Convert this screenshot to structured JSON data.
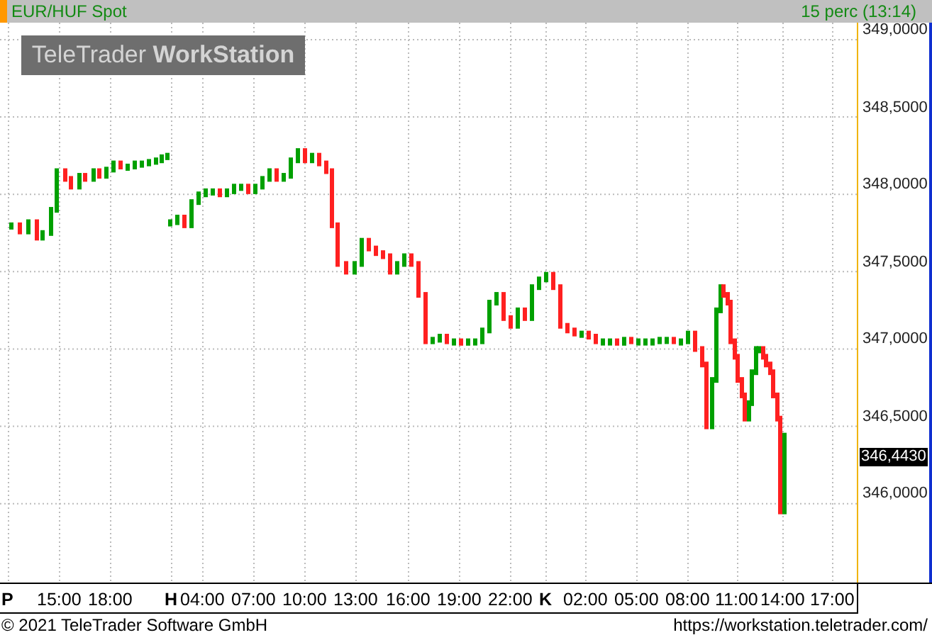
{
  "header": {
    "title": "EUR/HUF Spot",
    "interval": "15 perc (13:14)"
  },
  "logo": {
    "brand": "TeleTrader",
    "product": "WorkStation"
  },
  "y_axis": [
    "349,0000",
    "348,5000",
    "348,0000",
    "347,5000",
    "347,0000",
    "346,5000",
    "346,0000"
  ],
  "last_price": "346,4430",
  "x_axis": [
    {
      "label": "P",
      "kind": "day"
    },
    {
      "label": "15:00",
      "kind": "time"
    },
    {
      "label": "18:00",
      "kind": "time"
    },
    {
      "label": "H",
      "kind": "day"
    },
    {
      "label": "04:00",
      "kind": "time"
    },
    {
      "label": "07:00",
      "kind": "time"
    },
    {
      "label": "10:00",
      "kind": "time"
    },
    {
      "label": "13:00",
      "kind": "time"
    },
    {
      "label": "16:00",
      "kind": "time"
    },
    {
      "label": "19:00",
      "kind": "time"
    },
    {
      "label": "22:00",
      "kind": "time"
    },
    {
      "label": "K",
      "kind": "day"
    },
    {
      "label": "02:00",
      "kind": "time"
    },
    {
      "label": "05:00",
      "kind": "time"
    },
    {
      "label": "08:00",
      "kind": "time"
    },
    {
      "label": "11:00",
      "kind": "time"
    },
    {
      "label": "14:00",
      "kind": "time"
    },
    {
      "label": "17:00",
      "kind": "time"
    }
  ],
  "footer": {
    "copyright": "© 2021 TeleTrader Software GmbH",
    "url": "https://workstation.teletrader.com/"
  }
}
